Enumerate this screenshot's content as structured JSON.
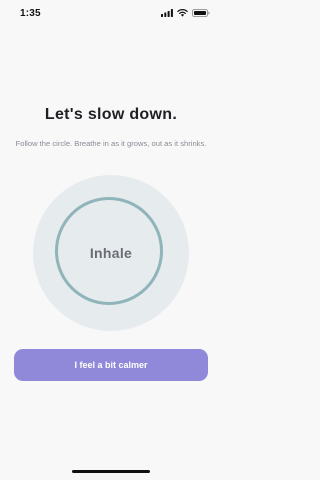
{
  "status_bar": {
    "time": "1:35",
    "icons": [
      "signal-icon",
      "wifi-icon",
      "battery-icon"
    ]
  },
  "main": {
    "title": "Let's slow down.",
    "subtitle": "Follow the circle. Breathe in as it grows, out as it shrinks.",
    "breath_phase": "Inhale",
    "calm_button_label": "I feel a bit calmer"
  },
  "colors": {
    "background": "#f8f8f9",
    "circle_fill": "#e6ebee",
    "circle_ring": "#8fb4b9",
    "button": "#9089d9"
  }
}
